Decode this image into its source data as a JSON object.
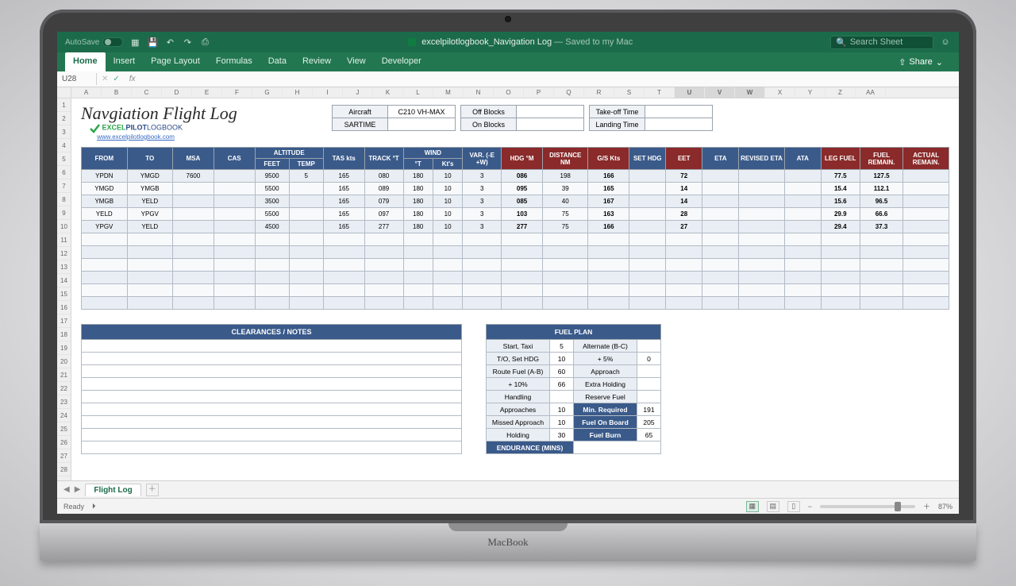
{
  "toolbar": {
    "autosave": "AutoSave",
    "doc_prefix": "excelpilotlogbook_Navigation Log",
    "doc_suffix": " — Saved to my Mac",
    "search_placeholder": "Search Sheet"
  },
  "ribbon": {
    "tabs": [
      "Home",
      "Insert",
      "Page Layout",
      "Formulas",
      "Data",
      "Review",
      "View",
      "Developer"
    ],
    "share": "Share"
  },
  "cellref": "U28",
  "columns": [
    "A",
    "B",
    "C",
    "D",
    "E",
    "F",
    "G",
    "H",
    "I",
    "J",
    "K",
    "L",
    "M",
    "N",
    "O",
    "P",
    "Q",
    "R",
    "S",
    "T",
    "U",
    "V",
    "W",
    "X",
    "Y",
    "Z",
    "AA"
  ],
  "title": "Navgiation Flight Log",
  "logo_text1": "EXCEL",
  "logo_text2": "PILOT",
  "logo_text3": "LOGBOOK",
  "logo_link": "www.excelpilotlogbook.com",
  "meta": {
    "aircraft_lbl": "Aircraft",
    "aircraft_val": "C210 VH-MAX",
    "offblocks": "Off Blocks",
    "takeoff": "Take-off Time",
    "sartime": "SARTIME",
    "onblocks": "On Blocks",
    "landing": "Landing Time"
  },
  "headers": {
    "from": "FROM",
    "to": "TO",
    "msa": "MSA",
    "cas": "CAS",
    "alt": "ALTITUDE",
    "feet": "FEET",
    "temp": "TEMP",
    "tas": "TAS kts",
    "track": "TRACK °T",
    "wind": "WIND",
    "wdir": "°T",
    "wspd": "Kt's",
    "var": "VAR. (-E +W)",
    "hdg": "HDG °M",
    "dist": "DISTANCE NM",
    "gs": "G/S Kts",
    "sethdg": "SET HDG",
    "eet": "EET",
    "eta": "ETA",
    "reta": "REVISED ETA",
    "ata": "ATA",
    "leg": "LEG FUEL",
    "frem": "FUEL REMAIN.",
    "arem": "ACTUAL REMAIN."
  },
  "rows": [
    {
      "from": "YPDN",
      "to": "YMGD",
      "msa": "7600",
      "cas": "",
      "feet": "9500",
      "temp": "5",
      "tas": "165",
      "trk": "080",
      "wd": "180",
      "ws": "10",
      "var": "3",
      "hdg": "086",
      "dist": "198",
      "gs": "166",
      "eet": "72",
      "leg": "77.5",
      "frem": "127.5"
    },
    {
      "from": "YMGD",
      "to": "YMGB",
      "msa": "",
      "cas": "",
      "feet": "5500",
      "temp": "",
      "tas": "165",
      "trk": "089",
      "wd": "180",
      "ws": "10",
      "var": "3",
      "hdg": "095",
      "dist": "39",
      "gs": "165",
      "eet": "14",
      "leg": "15.4",
      "frem": "112.1"
    },
    {
      "from": "YMGB",
      "to": "YELD",
      "msa": "",
      "cas": "",
      "feet": "3500",
      "temp": "",
      "tas": "165",
      "trk": "079",
      "wd": "180",
      "ws": "10",
      "var": "3",
      "hdg": "085",
      "dist": "40",
      "gs": "167",
      "eet": "14",
      "leg": "15.6",
      "frem": "96.5"
    },
    {
      "from": "YELD",
      "to": "YPGV",
      "msa": "",
      "cas": "",
      "feet": "5500",
      "temp": "",
      "tas": "165",
      "trk": "097",
      "wd": "180",
      "ws": "10",
      "var": "3",
      "hdg": "103",
      "dist": "75",
      "gs": "163",
      "eet": "28",
      "leg": "29.9",
      "frem": "66.6"
    },
    {
      "from": "YPGV",
      "to": "YELD",
      "msa": "",
      "cas": "",
      "feet": "4500",
      "temp": "",
      "tas": "165",
      "trk": "277",
      "wd": "180",
      "ws": "10",
      "var": "3",
      "hdg": "277",
      "dist": "75",
      "gs": "166",
      "eet": "27",
      "leg": "29.4",
      "frem": "37.3"
    }
  ],
  "notes_title": "CLEARANCES  /  NOTES",
  "fuel_title": "FUEL PLAN",
  "fuel": {
    "r1a": "Start, Taxi",
    "r1b": "5",
    "r1c": "Alternate (B-C)",
    "r1d": "",
    "r2a": "T/O, Set HDG",
    "r2b": "10",
    "r2c": "+ 5%",
    "r2d": "0",
    "r3a": "Route Fuel (A-B)",
    "r3b": "60",
    "r3c": "Approach",
    "r3d": "",
    "r4a": "+ 10%",
    "r4b": "66",
    "r4c": "Extra Holding",
    "r4d": "",
    "r5a": "Handling",
    "r5b": "",
    "r5c": "Reserve Fuel",
    "r5d": "",
    "r6a": "Approaches",
    "r6b": "10",
    "r6c": "Min. Required",
    "r6d": "191",
    "r7a": "Missed Approach",
    "r7b": "10",
    "r7c": "Fuel On Board",
    "r7d": "205",
    "r8a": "Holding",
    "r8b": "30",
    "r8c": "Fuel Burn",
    "r8d": "65",
    "endurance": "ENDURANCE (MINS)"
  },
  "tabbar": {
    "sheet": "Flight Log"
  },
  "status": {
    "ready": "Ready",
    "zoom": "87%"
  },
  "macbook": "MacBook"
}
